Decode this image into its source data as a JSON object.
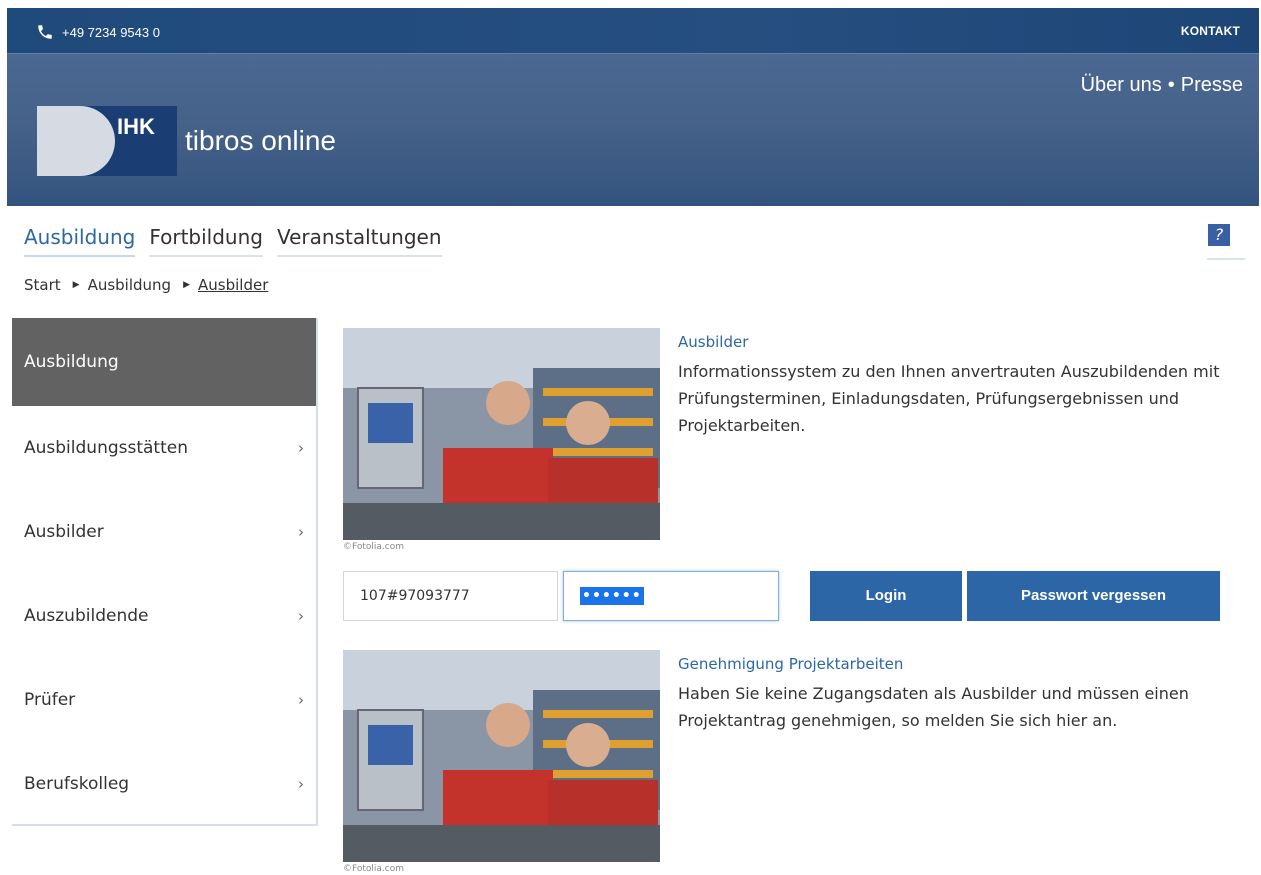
{
  "topbar": {
    "phone": "+49 7234 9543 0",
    "contact": "KONTAKT"
  },
  "header": {
    "links": [
      "Über uns",
      "Presse"
    ],
    "logo_short": "IHK",
    "logo_text": "tibros online"
  },
  "nav": {
    "tabs": [
      "Ausbildung",
      "Fortbildung",
      "Veranstaltungen"
    ],
    "active": "Ausbildung",
    "help": "?"
  },
  "breadcrumb": [
    "Start",
    "Ausbildung",
    "Ausbilder"
  ],
  "sidebar": {
    "items": [
      "Ausbildung",
      "Ausbildungsstätten",
      "Ausbilder",
      "Auszubildende",
      "Prüfer",
      "Berufskolleg"
    ],
    "active": "Ausbildung"
  },
  "content": {
    "image_credit": "©Fotolia.com",
    "ausbilder": {
      "title": "Ausbilder",
      "text": "Informationssystem zu den Ihnen anvertrauten Auszubildenden mit Prüfungsterminen, Einladungsdaten, Prüfungsergebnissen und Projektarbeiten."
    },
    "login": {
      "username_value": "107#97093777",
      "password_value": "••••••",
      "login_label": "Login",
      "forgot_label": "Passwort vergessen"
    },
    "genehmigung": {
      "title": "Genehmigung Projektarbeiten",
      "text": "Haben Sie keine Zugangsdaten als Ausbilder und müssen einen Projektantrag genehmigen, so melden Sie sich hier an."
    }
  },
  "colors": {
    "brand_dark": "#1f4a7c",
    "accent": "#2c66a6",
    "sidebar_active": "#626262"
  }
}
